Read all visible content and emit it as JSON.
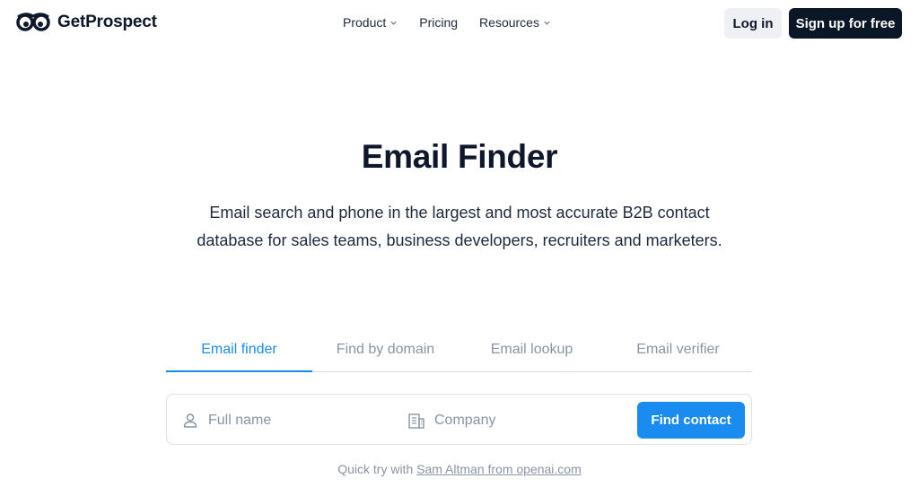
{
  "header": {
    "brand": "GetProspect",
    "nav": {
      "product": "Product",
      "pricing": "Pricing",
      "resources": "Resources"
    },
    "login_label": "Log in",
    "signup_label": "Sign up for free"
  },
  "hero": {
    "title": "Email Finder",
    "subtitle": "Email search and phone in the largest and most accurate B2B contact database for sales teams, business developers, recruiters and marketers."
  },
  "tabs": [
    {
      "label": "Email finder",
      "active": true
    },
    {
      "label": "Find by domain",
      "active": false
    },
    {
      "label": "Email lookup",
      "active": false
    },
    {
      "label": "Email verifier",
      "active": false
    }
  ],
  "search": {
    "full_name_placeholder": "Full name",
    "full_name_value": "",
    "company_placeholder": "Company",
    "company_value": "",
    "submit_label": "Find contact"
  },
  "quick_try": {
    "prefix": "Quick try with",
    "link_text": "Sam Altman from openai.com"
  },
  "icons": {
    "user": "user-icon",
    "company": "building-icon",
    "chevron": "chevron-down-icon",
    "logo": "owl-eyes-logo-icon"
  },
  "colors": {
    "accent": "#1a8cf0",
    "dark": "#0b1627",
    "muted": "#8a94a3"
  }
}
